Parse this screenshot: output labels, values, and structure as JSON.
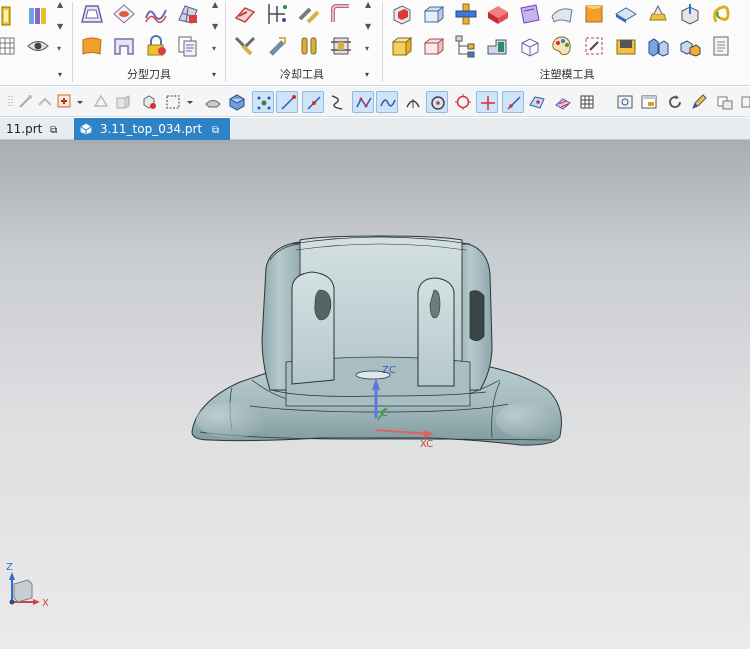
{
  "ribbon": {
    "groups": [
      {
        "label": ""
      },
      {
        "label": "分型刀具"
      },
      {
        "label": "冷却工具"
      },
      {
        "label": "注塑模工具"
      }
    ]
  },
  "tabs": [
    {
      "label": "11.prt"
    },
    {
      "label": "3.11_top_034.prt"
    }
  ],
  "viewport": {
    "csys": {
      "zc": "ZC",
      "c": "C",
      "xc": "XC"
    },
    "triad": {
      "z": "Z",
      "x": "X"
    }
  },
  "colors": {
    "tab_active": "#2f83c4",
    "part_body": "#a4bcc0",
    "viewport_top": "#a9adb2",
    "viewport_bottom": "#eaeaeb"
  }
}
